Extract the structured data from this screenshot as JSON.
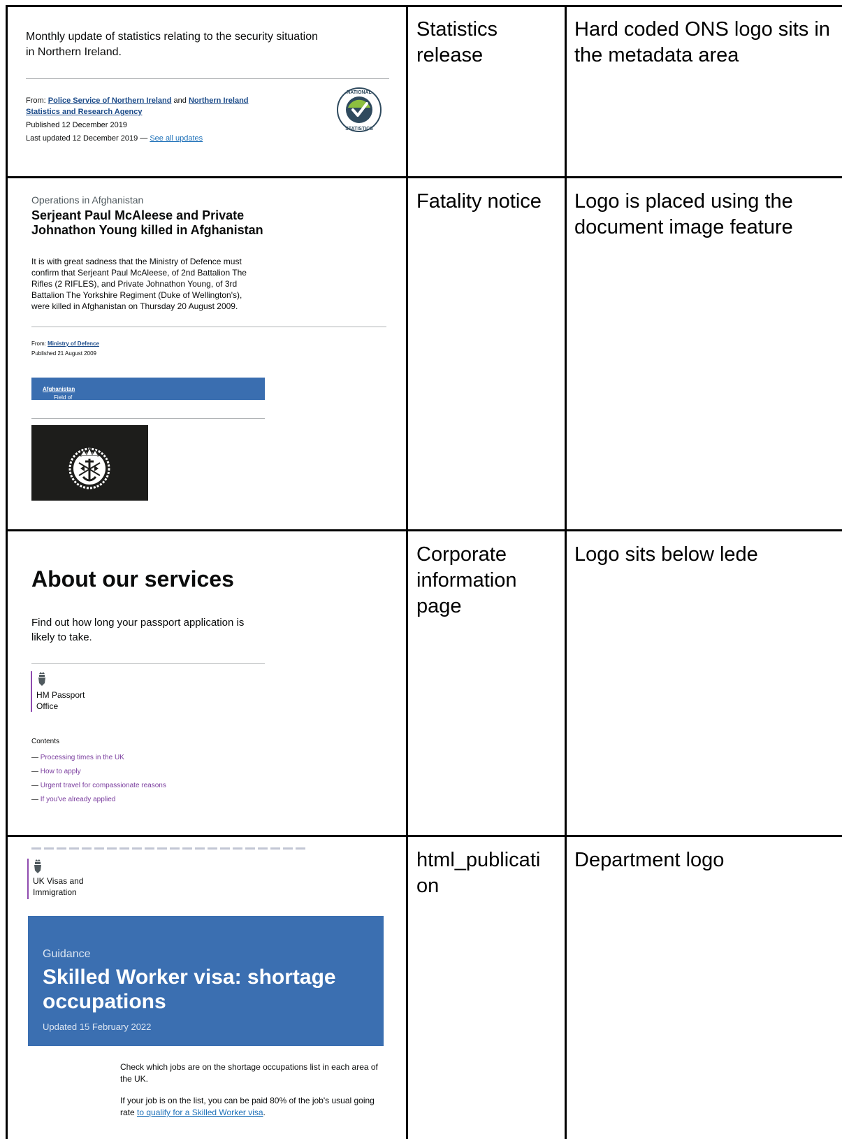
{
  "rows": [
    {
      "type_label": "Statistics release",
      "note": "Hard coded ONS logo sits in the metadata area",
      "shot": {
        "lede": "Monthly update of statistics relating to the security situation in Northern Ireland.",
        "from_label": "From:",
        "org1": "Police Service of Northern Ireland",
        "and": "and",
        "org2": "Northern Ireland Statistics and Research Agency",
        "published": "Published 12 December 2019",
        "updated": "Last updated 12 December 2019 —",
        "see_all": "See all updates",
        "seal_top": "NATIONAL",
        "seal_bottom": "STATISTICS"
      }
    },
    {
      "type_label": "Fatality notice",
      "note": "Logo is placed using the document image feature",
      "shot": {
        "kicker": "Operations in Afghanistan",
        "title": "Serjeant Paul McAleese and Private Johnathon Young killed in Afghanistan",
        "body": "It is with great sadness that the Ministry of Defence must confirm that Serjeant Paul McAleese, of 2nd Battalion The Rifles (2 RIFLES), and Private Johnathon Young, of 3rd Battalion The Yorkshire Regiment (Duke of Wellington's), were killed in Afghanistan on Thursday 20 August 2009.",
        "from_label": "From:",
        "org": "Ministry of Defence",
        "published": "Published 21 August 2009",
        "field_label": "Field of operation:",
        "field_value": "Afghanistan"
      }
    },
    {
      "type_label": "Corporate information page",
      "note": "Logo sits below lede",
      "shot": {
        "heading": "About our services",
        "lede": "Find out how long your passport application is likely to take.",
        "org_name": "HM Passport Office",
        "contents_heading": "Contents",
        "contents": [
          "Processing times in the UK",
          "How to apply",
          "Urgent travel for compassionate reasons",
          "If you've already applied"
        ]
      }
    },
    {
      "type_label": "html_publication",
      "note": "Department logo",
      "shot": {
        "org_name": "UK Visas and Immigration",
        "kind": "Guidance",
        "title": "Skilled Worker visa: shortage occupations",
        "updated": "Updated 15 February 2022",
        "para1": "Check which jobs are on the shortage occupations list in each area of the UK.",
        "para2_prefix": "If your job is on the list, you can be paid 80% of the job's usual going rate",
        "para2_link": "to qualify for a Skilled Worker visa",
        "para2_suffix": "."
      }
    }
  ]
}
